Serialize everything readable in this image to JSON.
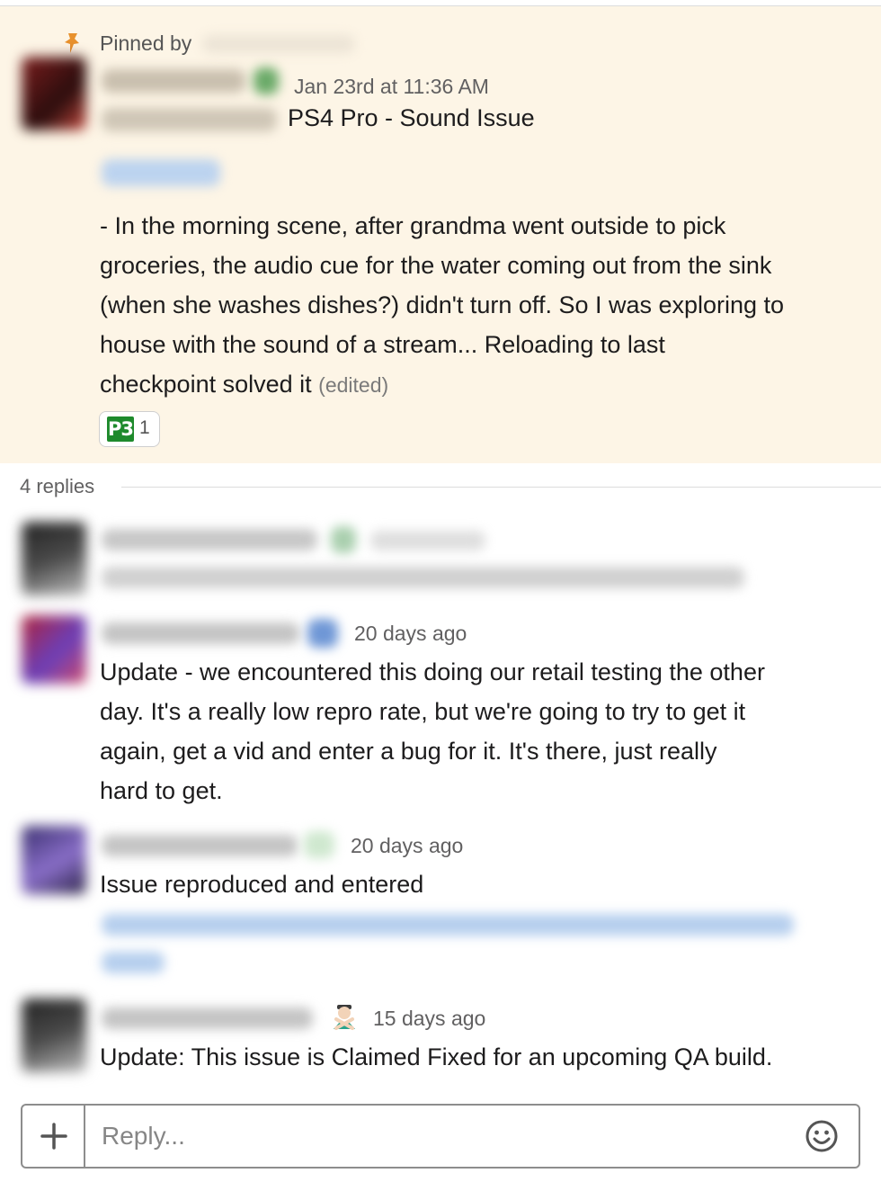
{
  "pinned": {
    "label": "Pinned by",
    "timestamp": "Jan 23rd at 11:36 AM",
    "title": "PS4 Pro - Sound Issue",
    "body_lines": [
      "- In the morning scene, after grandma went outside to pick",
      "groceries, the audio cue for the water coming out from the sink",
      "(when she washes dishes?) didn't turn off. So I was exploring to",
      "house with the sound of a stream... Reloading to last",
      "checkpoint solved it"
    ],
    "edited": "(edited)",
    "reaction": {
      "emoji_label": "P3",
      "count": "1",
      "emoji_color": "#1e8a2c"
    }
  },
  "thread": {
    "replies_label": "4 replies",
    "replies": [
      {
        "timestamp": "20 days ago",
        "lines": [
          "Update - we encountered this doing our retail testing the other",
          "day.  It's a really low repro rate, but we're going to try to get it",
          "again, get  a vid and enter a bug for it.  It's there, just really",
          "hard to get."
        ]
      },
      {
        "timestamp": "20 days ago",
        "lines": [
          "Issue reproduced and entered"
        ]
      },
      {
        "timestamp": "15 days ago",
        "status_icon": "person-gesturing-no-icon",
        "lines": [
          "Update: This issue is Claimed Fixed for an upcoming QA build."
        ]
      }
    ]
  },
  "composer": {
    "placeholder": "Reply...",
    "plus_icon": "plus-icon",
    "emoji_icon": "smiley-icon"
  },
  "colors": {
    "pinned_background": "#fdf5e6",
    "pin_icon": "#e8912d",
    "link_blur": "#a9c7ec"
  }
}
